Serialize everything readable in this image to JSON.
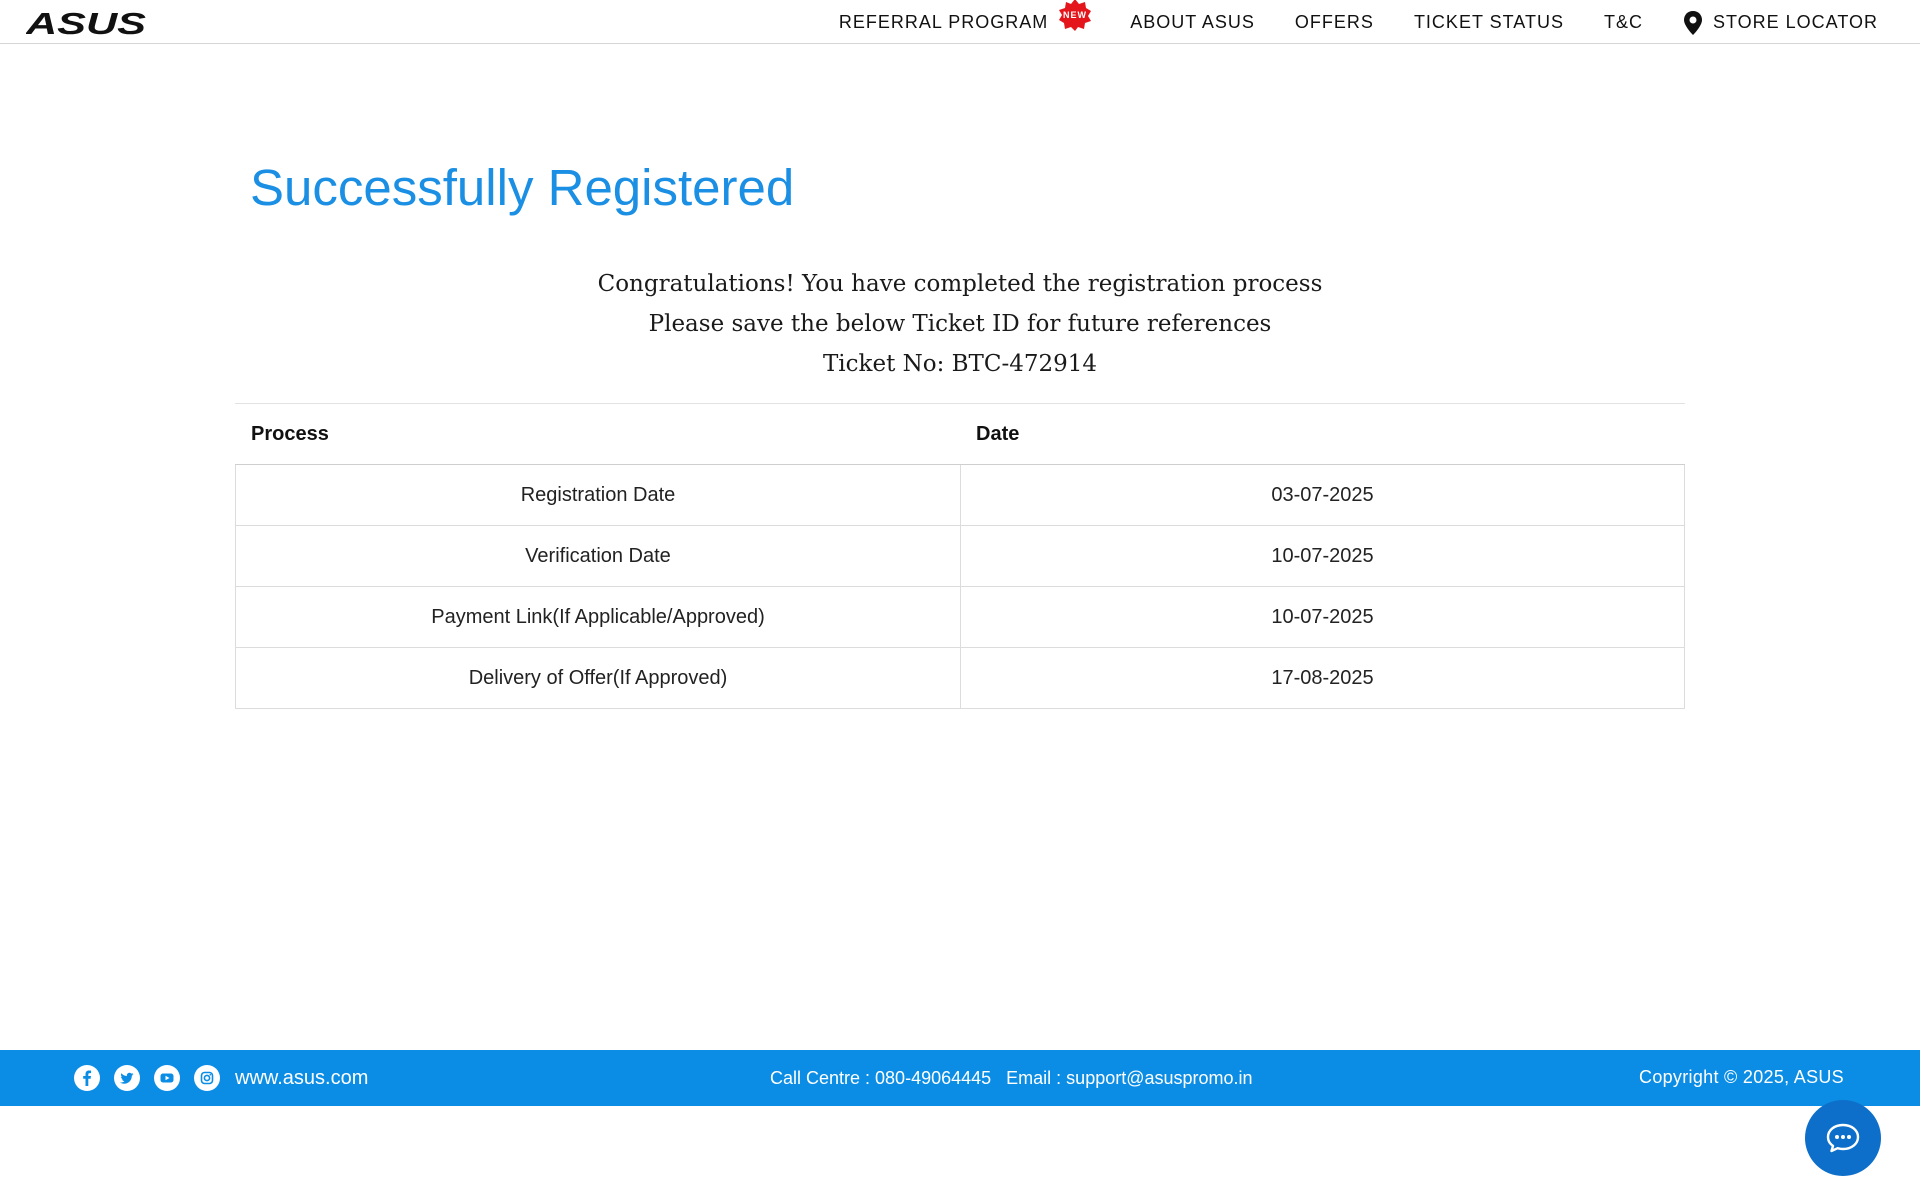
{
  "brand": {
    "logo_text": "ASUS"
  },
  "nav": {
    "items": [
      {
        "label": "REFERRAL PROGRAM",
        "badge": "NEW"
      },
      {
        "label": "ABOUT ASUS"
      },
      {
        "label": "OFFERS"
      },
      {
        "label": "TICKET STATUS"
      },
      {
        "label": "T&C"
      },
      {
        "label": "STORE LOCATOR",
        "icon": "location-pin-icon"
      }
    ]
  },
  "main": {
    "title": "Successfully Registered",
    "message_lines": [
      "Congratulations! You have completed the registration process",
      "Please save the below Ticket ID for future references",
      "Ticket No: BTC-472914"
    ],
    "table": {
      "headers": [
        "Process",
        "Date"
      ],
      "rows": [
        [
          "Registration Date",
          "03-07-2025"
        ],
        [
          "Verification Date",
          "10-07-2025"
        ],
        [
          "Payment Link(If Applicable/Approved)",
          "10-07-2025"
        ],
        [
          "Delivery of Offer(If Approved)",
          "17-08-2025"
        ]
      ]
    }
  },
  "footer": {
    "social_icons": [
      "facebook-icon",
      "twitter-icon",
      "youtube-icon",
      "instagram-icon"
    ],
    "site_link": "www.asus.com",
    "call_centre": "Call Centre : 080-49064445",
    "email": "Email : support@asuspromo.in",
    "copyright": "Copyright © 2025, ASUS"
  },
  "colors": {
    "title": "#1a8fe3",
    "footer_bg": "#0b8de6",
    "chat_button": "#0d6fc9",
    "badge": "#e4161b"
  }
}
